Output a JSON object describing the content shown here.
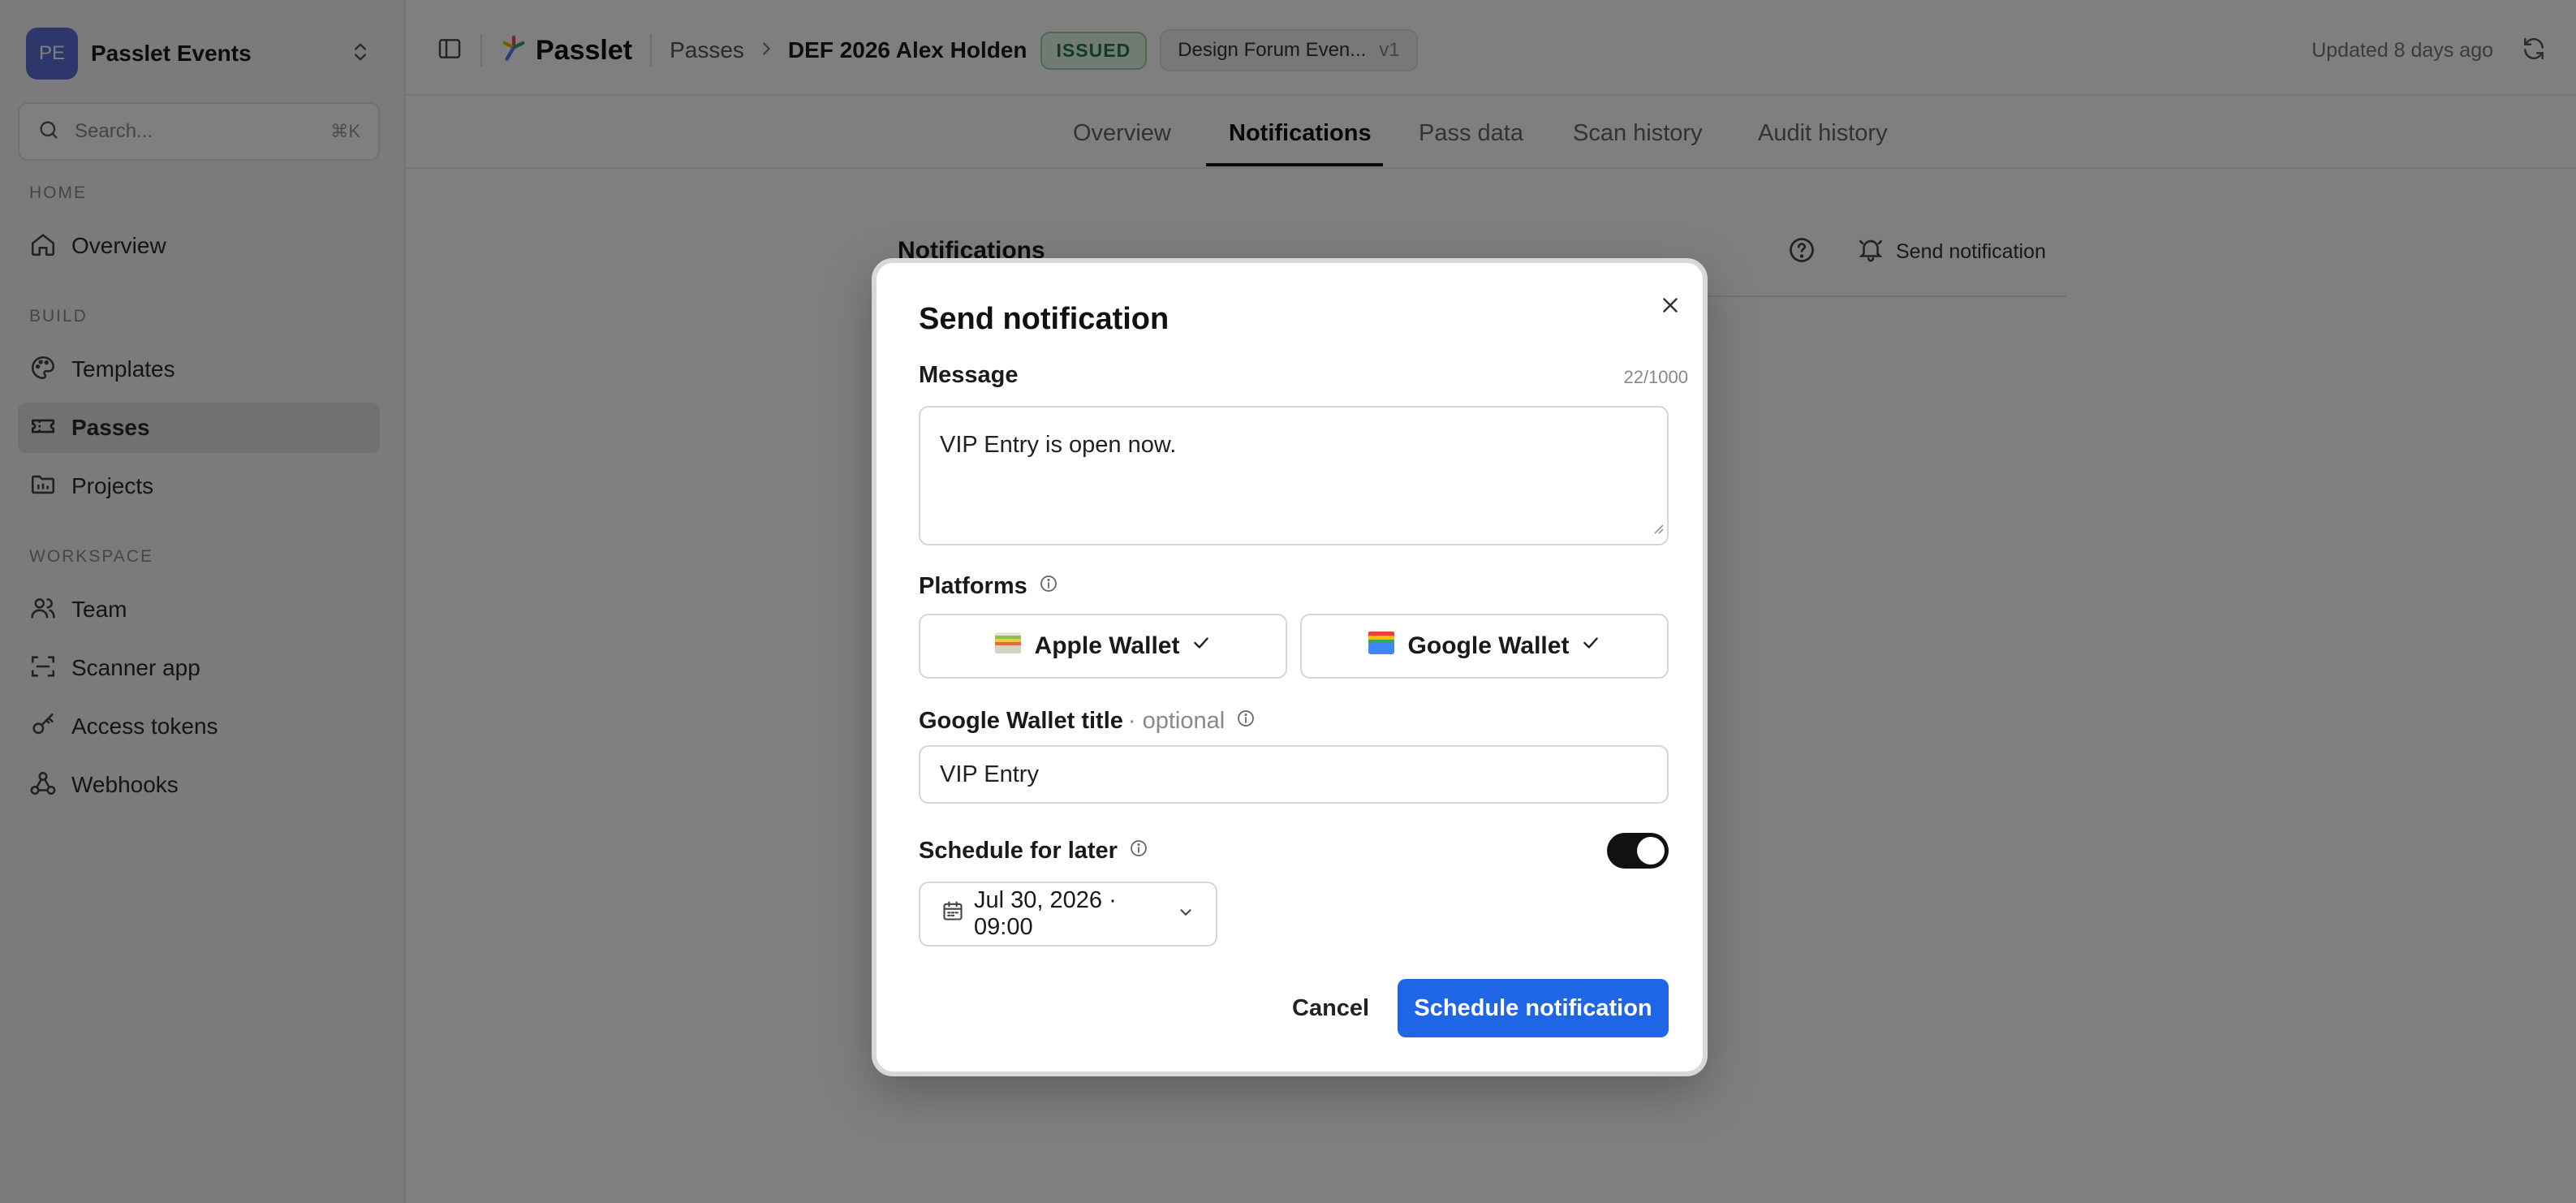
{
  "workspace": {
    "initials": "PE",
    "name": "Passlet Events"
  },
  "search": {
    "placeholder": "Search...",
    "shortcut": "⌘K"
  },
  "sidebar": {
    "sections": [
      {
        "title": "HOME",
        "items": [
          {
            "label": "Overview",
            "icon": "home-icon"
          }
        ]
      },
      {
        "title": "BUILD",
        "items": [
          {
            "label": "Templates",
            "icon": "palette-icon"
          },
          {
            "label": "Passes",
            "icon": "ticket-icon",
            "active": true
          },
          {
            "label": "Projects",
            "icon": "folder-icon"
          }
        ]
      },
      {
        "title": "WORKSPACE",
        "items": [
          {
            "label": "Team",
            "icon": "users-icon"
          },
          {
            "label": "Scanner app",
            "icon": "scan-icon"
          },
          {
            "label": "Access tokens",
            "icon": "key-icon"
          },
          {
            "label": "Webhooks",
            "icon": "webhook-icon"
          }
        ]
      }
    ]
  },
  "header": {
    "logo_text": "Passlet",
    "breadcrumb_parent": "Passes",
    "breadcrumb_current": "DEF 2026 Alex Holden",
    "status_badge": "ISSUED",
    "template_name": "Design Forum Even...",
    "template_version": "v1",
    "updated_text": "Updated 8 days ago"
  },
  "tabs": [
    {
      "label": "Overview"
    },
    {
      "label": "Notifications",
      "active": true
    },
    {
      "label": "Pass data"
    },
    {
      "label": "Scan history"
    },
    {
      "label": "Audit history"
    }
  ],
  "content": {
    "title": "Notifications",
    "send_label": "Send notification"
  },
  "modal": {
    "title": "Send notification",
    "message_label": "Message",
    "message_counter": "22/1000",
    "message_value": "VIP Entry is open now.",
    "platforms_label": "Platforms",
    "platforms": [
      {
        "label": "Apple Wallet",
        "selected": true,
        "icon": "apple-wallet-icon"
      },
      {
        "label": "Google Wallet",
        "selected": true,
        "icon": "google-wallet-icon"
      }
    ],
    "google_title_label": "Google Wallet title",
    "google_title_optional": "· optional",
    "google_title_value": "VIP Entry",
    "schedule_label": "Schedule for later",
    "schedule_enabled": true,
    "schedule_datetime": "Jul 30, 2026 · 09:00",
    "cancel_label": "Cancel",
    "submit_label": "Schedule notification"
  },
  "colors": {
    "primary": "#1e66e6",
    "badge_bg": "#e5f4e8",
    "badge_text": "#217a3a",
    "avatar": "#5b6fd6"
  }
}
